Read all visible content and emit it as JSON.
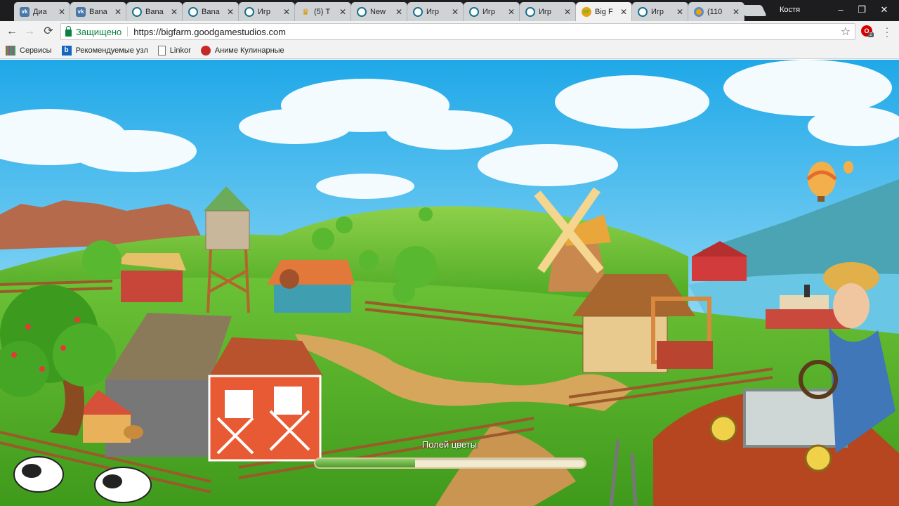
{
  "tabs": [
    {
      "title": "Диа",
      "icon": "vk-icon"
    },
    {
      "title": "Bana",
      "icon": "vk-icon"
    },
    {
      "title": "Bana",
      "icon": "goodgame-icon"
    },
    {
      "title": "Bana",
      "icon": "goodgame-icon"
    },
    {
      "title": "Игр",
      "icon": "goodgame-icon"
    },
    {
      "title": "(5) Т",
      "icon": "crown-icon"
    },
    {
      "title": "New",
      "icon": "goodgame-icon"
    },
    {
      "title": "Игр",
      "icon": "goodgame-icon"
    },
    {
      "title": "Игр",
      "icon": "goodgame-icon"
    },
    {
      "title": "Игр",
      "icon": "goodgame-icon"
    },
    {
      "title": "Big F",
      "icon": "bigfarm-icon",
      "active": true
    },
    {
      "title": "Игр",
      "icon": "goodgame-icon"
    },
    {
      "title": "(110",
      "icon": "ring-icon"
    }
  ],
  "window": {
    "user": "Костя",
    "minimize": "–",
    "maximize": "❐",
    "close": "✕"
  },
  "nav": {
    "back": "←",
    "forward": "→",
    "reload": "⟳"
  },
  "address": {
    "secure_label": "Защищено",
    "url": "https://bigfarm.goodgamestudios.com",
    "star": "☆"
  },
  "extension": {
    "badge": "2"
  },
  "bookmarks": [
    {
      "label": "Сервисы",
      "icon": "apps-icon"
    },
    {
      "label": "Рекомендуемые узл",
      "icon": "bing-icon"
    },
    {
      "label": "Linkor",
      "icon": "page-icon"
    },
    {
      "label": "Аниме Кулинарные",
      "icon": "anime-icon"
    }
  ],
  "game": {
    "loading_text": "Полей цветы",
    "progress": 0.37
  },
  "colors": {
    "secure": "#0b8043",
    "progress": "#5aa832"
  }
}
